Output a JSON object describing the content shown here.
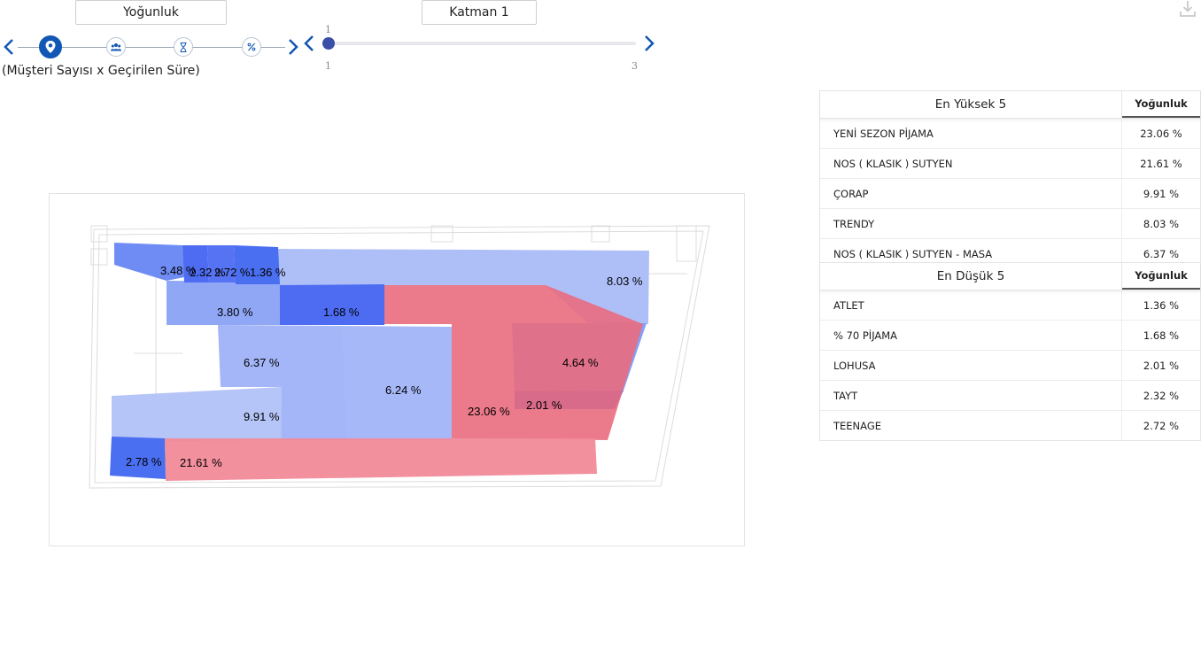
{
  "controls": {
    "metric_button": "Yoğunluk",
    "layer_button": "Katman 1",
    "metric_subtitle": "(Müşteri Sayısı x Geçirilen Süre)",
    "metric_steps": [
      {
        "name": "location",
        "icon": "map-pin-icon"
      },
      {
        "name": "customers",
        "icon": "people-icon"
      },
      {
        "name": "duration",
        "icon": "hourglass-icon"
      },
      {
        "name": "percentage",
        "icon": "percent-icon"
      }
    ],
    "active_step": 0,
    "layer_slider": {
      "current_label": "1",
      "min_label": "1",
      "max_label": "3",
      "value": 1,
      "min": 1,
      "max": 3
    }
  },
  "floor_plan": {
    "colors": {
      "low": "#4a6ff0",
      "mid": "#8aa2f5",
      "light": "#aabcf8",
      "high": "#e96b7e"
    },
    "zones": [
      {
        "name": "ATLET",
        "value": "1.36 %"
      },
      {
        "name": "% 70 PİJAMA",
        "value": "1.68 %"
      },
      {
        "name": "LOHUSA",
        "value": "2.01 %"
      },
      {
        "name": "TAYT",
        "value": "2.32 %"
      },
      {
        "name": "TEENAGE",
        "value": "2.72 %"
      },
      {
        "name": "zone-a",
        "value": "2.78 %"
      },
      {
        "name": "zone-b",
        "value": "3.48 %"
      },
      {
        "name": "zone-c",
        "value": "3.80 %"
      },
      {
        "name": "zone-d",
        "value": "4.64 %"
      },
      {
        "name": "zone-e",
        "value": "6.24 %"
      },
      {
        "name": "NOS ( KLASIK ) SUTYEN - MASA",
        "value": "6.37 %"
      },
      {
        "name": "TRENDY",
        "value": "8.03 %"
      },
      {
        "name": "ÇORAP",
        "value": "9.91 %"
      },
      {
        "name": "NOS ( KLASIK ) SUTYEN",
        "value": "21.61 %"
      },
      {
        "name": "YENİ SEZON PİJAMA",
        "value": "23.06 %"
      }
    ]
  },
  "top5": {
    "title": "En Yüksek 5",
    "column": "Yoğunluk",
    "rows": [
      {
        "name": "YENİ SEZON PİJAMA",
        "value": "23.06 %"
      },
      {
        "name": "NOS ( KLASIK ) SUTYEN",
        "value": "21.61 %"
      },
      {
        "name": "ÇORAP",
        "value": "9.91 %"
      },
      {
        "name": "TRENDY",
        "value": "8.03 %"
      },
      {
        "name": "NOS ( KLASIK ) SUTYEN - MASA",
        "value": "6.37 %"
      }
    ]
  },
  "bottom5": {
    "title": "En Düşük 5",
    "column": "Yoğunluk",
    "rows": [
      {
        "name": "ATLET",
        "value": "1.36 %"
      },
      {
        "name": "% 70 PİJAMA",
        "value": "1.68 %"
      },
      {
        "name": "LOHUSA",
        "value": "2.01 %"
      },
      {
        "name": "TAYT",
        "value": "2.32 %"
      },
      {
        "name": "TEENAGE",
        "value": "2.72 %"
      }
    ]
  }
}
